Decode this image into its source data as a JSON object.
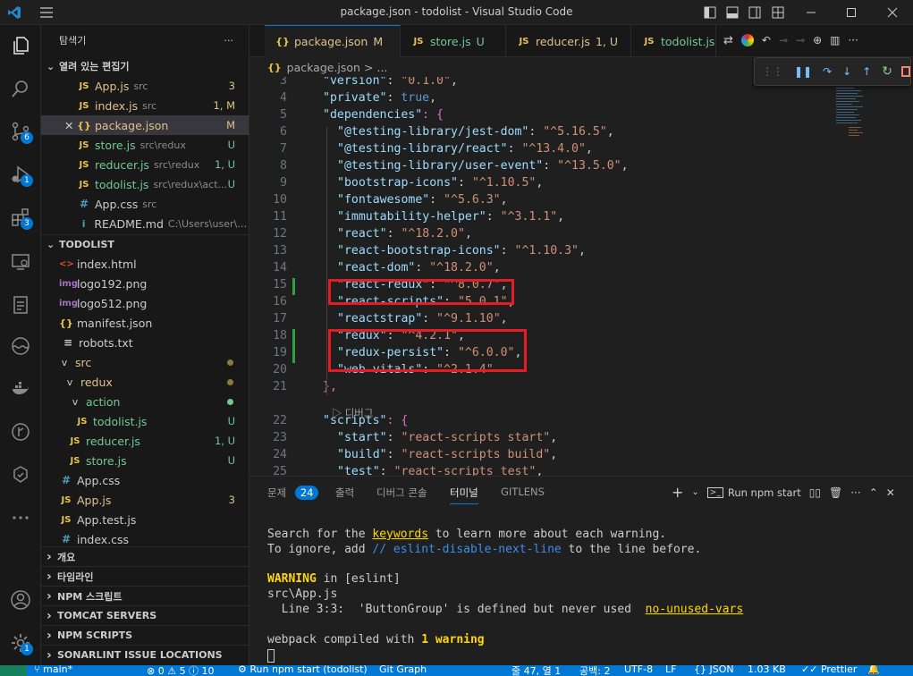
{
  "window": {
    "title": "package.json - todolist - Visual Studio Code"
  },
  "activity": {
    "scm_badge": "6",
    "debug_badge": "1",
    "ext_badge": "3",
    "account_badge": "1"
  },
  "explorer": {
    "title": "탐색기",
    "open_editors_label": "열려 있는 편집기",
    "open_editors": [
      {
        "icon": "JS",
        "name": "App.js",
        "desc": "src",
        "status": "3"
      },
      {
        "icon": "JS",
        "name": "index.js",
        "desc": "src",
        "status": "1, M"
      },
      {
        "icon": "{}",
        "name": "package.json",
        "desc": "",
        "status": "M"
      },
      {
        "icon": "JS",
        "name": "store.js",
        "desc": "src\\redux",
        "status": "U"
      },
      {
        "icon": "JS",
        "name": "reducer.js",
        "desc": "src\\redux",
        "status": "1, U"
      },
      {
        "icon": "JS",
        "name": "todolist.js",
        "desc": "src\\redux\\act...",
        "status": "U"
      },
      {
        "icon": "#",
        "name": "App.css",
        "desc": "src",
        "status": ""
      },
      {
        "icon": "i",
        "name": "README.md",
        "desc": "C:\\Users\\user\\g...",
        "status": ""
      }
    ],
    "project_label": "TODOLIST",
    "tree": [
      {
        "icon": "<>",
        "name": "index.html"
      },
      {
        "icon": "img",
        "name": "logo192.png"
      },
      {
        "icon": "img",
        "name": "logo512.png"
      },
      {
        "icon": "{}",
        "name": "manifest.json"
      },
      {
        "icon": "≡",
        "name": "robots.txt"
      },
      {
        "icon": "v",
        "name": "src"
      },
      {
        "icon": "v",
        "name": "redux"
      },
      {
        "icon": "v",
        "name": "action"
      },
      {
        "icon": "JS",
        "name": "todolist.js",
        "status": "U"
      },
      {
        "icon": "JS",
        "name": "reducer.js",
        "status": "1, U"
      },
      {
        "icon": "JS",
        "name": "store.js",
        "status": "U"
      },
      {
        "icon": "#",
        "name": "App.css"
      },
      {
        "icon": "JS",
        "name": "App.js",
        "status": "3"
      },
      {
        "icon": "JS",
        "name": "App.test.js"
      },
      {
        "icon": "#",
        "name": "index.css"
      }
    ],
    "sections": [
      "개요",
      "타임라인",
      "NPM 스크립트",
      "TOMCAT SERVERS",
      "NPM SCRIPTS",
      "SONARLINT ISSUE LOCATIONS"
    ]
  },
  "tabs": [
    {
      "icon": "{}",
      "label": "package.json",
      "status": "M"
    },
    {
      "icon": "JS",
      "label": "store.js",
      "status": "U"
    },
    {
      "icon": "JS",
      "label": "reducer.js",
      "status": "1, U"
    },
    {
      "icon": "JS",
      "label": "todolist.js",
      "status": ""
    }
  ],
  "breadcrumb": {
    "file": "package.json",
    "sep": ">",
    "rest": "..."
  },
  "code": {
    "lines": [
      {
        "n": "3",
        "key": "\"version\"",
        "val": "\"0.1.0\"",
        "tail": ","
      },
      {
        "n": "4",
        "key": "\"private\"",
        "val": "true",
        "tail": ","
      },
      {
        "n": "5",
        "key": "\"dependencies\"",
        "val": "",
        "tail": ": {"
      },
      {
        "n": "6",
        "key": "\"@testing-library/jest-dom\"",
        "val": "\"^5.16.5\"",
        "tail": ","
      },
      {
        "n": "7",
        "key": "\"@testing-library/react\"",
        "val": "\"^13.4.0\"",
        "tail": ","
      },
      {
        "n": "8",
        "key": "\"@testing-library/user-event\"",
        "val": "\"^13.5.0\"",
        "tail": ","
      },
      {
        "n": "9",
        "key": "\"bootstrap-icons\"",
        "val": "\"^1.10.5\"",
        "tail": ","
      },
      {
        "n": "10",
        "key": "\"fontawesome\"",
        "val": "\"^5.6.3\"",
        "tail": ","
      },
      {
        "n": "11",
        "key": "\"immutability-helper\"",
        "val": "\"^3.1.1\"",
        "tail": ","
      },
      {
        "n": "12",
        "key": "\"react\"",
        "val": "\"^18.2.0\"",
        "tail": ","
      },
      {
        "n": "13",
        "key": "\"react-bootstrap-icons\"",
        "val": "\"^1.10.3\"",
        "tail": ","
      },
      {
        "n": "14",
        "key": "\"react-dom\"",
        "val": "\"^18.2.0\"",
        "tail": ","
      },
      {
        "n": "15",
        "key": "\"react-redux\"",
        "val": "\"^8.0.7\"",
        "tail": ","
      },
      {
        "n": "16",
        "key": "\"react-scripts\"",
        "val": "\"5.0.1\"",
        "tail": ","
      },
      {
        "n": "17",
        "key": "\"reactstrap\"",
        "val": "\"^9.1.10\"",
        "tail": ","
      },
      {
        "n": "18",
        "key": "\"redux\"",
        "val": "\"^4.2.1\"",
        "tail": ","
      },
      {
        "n": "19",
        "key": "\"redux-persist\"",
        "val": "\"^6.0.0\"",
        "tail": ","
      },
      {
        "n": "20",
        "key": "\"web-vitals\"",
        "val": "\"^2.1.4\"",
        "tail": ""
      },
      {
        "n": "21",
        "key": "",
        "val": "",
        "tail": "},"
      },
      {
        "n": "22",
        "key": "\"scripts\"",
        "val": "",
        "tail": ": {"
      },
      {
        "n": "23",
        "key": "\"start\"",
        "val": "\"react-scripts start\"",
        "tail": ","
      },
      {
        "n": "24",
        "key": "\"build\"",
        "val": "\"react-scripts build\"",
        "tail": ","
      },
      {
        "n": "25",
        "key": "\"test\"",
        "val": "\"react-scripts test\"",
        "tail": ","
      }
    ],
    "codelens": "디버그"
  },
  "panel": {
    "tabs": [
      "문제",
      "출력",
      "디버그 콘솔",
      "터미널",
      "GITLENS"
    ],
    "problems_count": "24",
    "run_label": "Run npm start",
    "terminal": {
      "l1a": "Search for the ",
      "l1b": "keywords",
      "l1c": " to learn more about each warning.",
      "l2a": "To ignore, add ",
      "l2b": "// eslint-disable-next-line",
      "l2c": " to the line before.",
      "l3a": "WARNING",
      "l3b": " in [eslint]",
      "l4": "src\\App.js",
      "l5a": "  Line 3:3:  'ButtonGroup' is defined but never used  ",
      "l5b": "no-unused-vars",
      "l6a": "webpack compiled with ",
      "l6b": "1 warning",
      "l6c": ""
    }
  },
  "statusbar": {
    "branch": "main*",
    "problems": "⊗ 0 ⚠ 5 ⓘ 10",
    "run": "Run npm start (todolist)",
    "git_graph": "Git Graph",
    "pos": "줄 47, 열 1",
    "spaces": "공백: 2",
    "enc": "UTF-8",
    "eol": "LF",
    "lang": "{} JSON",
    "size": "1.03 KB",
    "prettier": "Prettier"
  },
  "colors": {
    "accent": "#0078d4",
    "highlight": "#e51c23",
    "untracked": "#73c991",
    "modified": "#e2c08d"
  }
}
